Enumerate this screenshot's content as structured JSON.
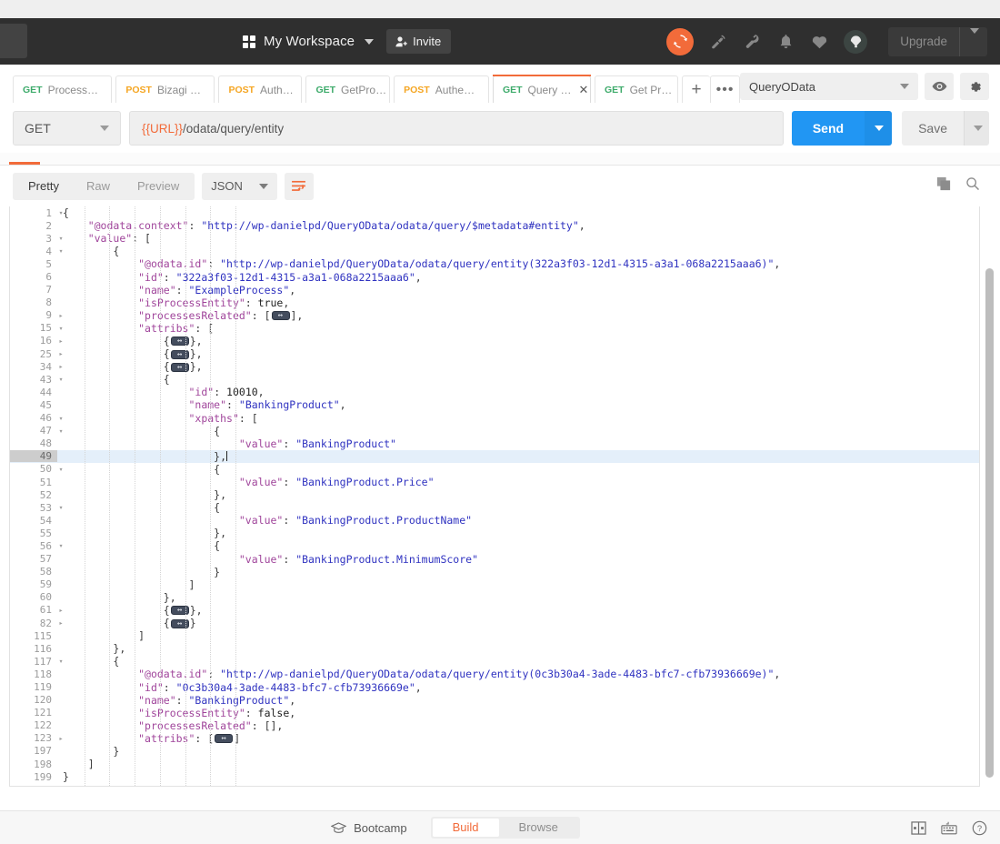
{
  "header": {
    "workspace_label": "My Workspace",
    "invite_label": "Invite",
    "upgrade_label": "Upgrade",
    "icons": [
      "grid-icon",
      "user-add-icon",
      "chevron-down-icon",
      "sync-icon",
      "satellite-icon",
      "wrench-icon",
      "bell-icon",
      "heart-icon",
      "parachute-icon"
    ],
    "accent_orange": "#f26b3a",
    "bg": "#2f2f2f"
  },
  "tabs": {
    "items": [
      {
        "method": "GET",
        "name": "Process…",
        "unsaved": true,
        "active": false,
        "closable": false
      },
      {
        "method": "POST",
        "name": "Bizagi …",
        "unsaved": true,
        "active": false,
        "closable": false
      },
      {
        "method": "POST",
        "name": "Auth…",
        "unsaved": false,
        "active": false,
        "closable": false
      },
      {
        "method": "GET",
        "name": "GetPro…",
        "unsaved": false,
        "active": false,
        "closable": false
      },
      {
        "method": "POST",
        "name": "Authe…",
        "unsaved": true,
        "active": false,
        "closable": false
      },
      {
        "method": "GET",
        "name": "Query …",
        "unsaved": false,
        "active": true,
        "closable": true
      },
      {
        "method": "GET",
        "name": "Get Pr…",
        "unsaved": false,
        "active": false,
        "closable": false
      }
    ],
    "new_tab_label": "+",
    "more_label": "•••",
    "environment": "QueryOData",
    "eye_icon": "eye-icon",
    "gear_icon": "gear-icon"
  },
  "request": {
    "method": "GET",
    "url_variable": "{{URL}}",
    "url_path": "/odata/query/entity",
    "send_label": "Send",
    "save_label": "Save"
  },
  "response": {
    "view_tabs": [
      {
        "label": "Pretty",
        "active": true
      },
      {
        "label": "Raw",
        "active": false
      },
      {
        "label": "Preview",
        "active": false
      }
    ],
    "format": "JSON",
    "wrap_icon": "word-wrap-icon",
    "copy_icon": "copy-icon",
    "search_icon": "search-icon",
    "highlighted_line": 49,
    "lines": [
      {
        "n": "1",
        "fold": "down",
        "indent": 0,
        "tokens": [
          {
            "t": "p",
            "v": "{"
          }
        ]
      },
      {
        "n": "2",
        "fold": "",
        "indent": 1,
        "tokens": [
          {
            "t": "k",
            "v": "\"@odata.context\""
          },
          {
            "t": "p",
            "v": ": "
          },
          {
            "t": "s",
            "v": "\"http://wp-danielpd/QueryOData/odata/query/$metadata#entity\""
          },
          {
            "t": "p",
            "v": ","
          }
        ]
      },
      {
        "n": "3",
        "fold": "down",
        "indent": 1,
        "tokens": [
          {
            "t": "k",
            "v": "\"value\""
          },
          {
            "t": "p",
            "v": ": ["
          }
        ]
      },
      {
        "n": "4",
        "fold": "down",
        "indent": 2,
        "tokens": [
          {
            "t": "p",
            "v": "{"
          }
        ]
      },
      {
        "n": "5",
        "fold": "",
        "indent": 3,
        "tokens": [
          {
            "t": "k",
            "v": "\"@odata.id\""
          },
          {
            "t": "p",
            "v": ": "
          },
          {
            "t": "s",
            "v": "\"http://wp-danielpd/QueryOData/odata/query/entity(322a3f03-12d1-4315-a3a1-068a2215aaa6)\""
          },
          {
            "t": "p",
            "v": ","
          }
        ]
      },
      {
        "n": "6",
        "fold": "",
        "indent": 3,
        "tokens": [
          {
            "t": "k",
            "v": "\"id\""
          },
          {
            "t": "p",
            "v": ": "
          },
          {
            "t": "s",
            "v": "\"322a3f03-12d1-4315-a3a1-068a2215aaa6\""
          },
          {
            "t": "p",
            "v": ","
          }
        ]
      },
      {
        "n": "7",
        "fold": "",
        "indent": 3,
        "tokens": [
          {
            "t": "k",
            "v": "\"name\""
          },
          {
            "t": "p",
            "v": ": "
          },
          {
            "t": "s",
            "v": "\"ExampleProcess\""
          },
          {
            "t": "p",
            "v": ","
          }
        ]
      },
      {
        "n": "8",
        "fold": "",
        "indent": 3,
        "tokens": [
          {
            "t": "k",
            "v": "\"isProcessEntity\""
          },
          {
            "t": "p",
            "v": ": "
          },
          {
            "t": "b",
            "v": "true"
          },
          {
            "t": "p",
            "v": ","
          }
        ]
      },
      {
        "n": "9",
        "fold": "right",
        "indent": 3,
        "tokens": [
          {
            "t": "k",
            "v": "\"processesRelated\""
          },
          {
            "t": "p",
            "v": ": ["
          },
          {
            "t": "badge",
            "v": ""
          },
          {
            "t": "p",
            "v": "],"
          }
        ]
      },
      {
        "n": "15",
        "fold": "down",
        "indent": 3,
        "tokens": [
          {
            "t": "k",
            "v": "\"attribs\""
          },
          {
            "t": "p",
            "v": ": ["
          }
        ]
      },
      {
        "n": "16",
        "fold": "right",
        "indent": 4,
        "tokens": [
          {
            "t": "p",
            "v": "{"
          },
          {
            "t": "badge",
            "v": ""
          },
          {
            "t": "p",
            "v": "},"
          }
        ]
      },
      {
        "n": "25",
        "fold": "right",
        "indent": 4,
        "tokens": [
          {
            "t": "p",
            "v": "{"
          },
          {
            "t": "badge",
            "v": ""
          },
          {
            "t": "p",
            "v": "},"
          }
        ]
      },
      {
        "n": "34",
        "fold": "right",
        "indent": 4,
        "tokens": [
          {
            "t": "p",
            "v": "{"
          },
          {
            "t": "badge",
            "v": ""
          },
          {
            "t": "p",
            "v": "},"
          }
        ]
      },
      {
        "n": "43",
        "fold": "down",
        "indent": 4,
        "tokens": [
          {
            "t": "p",
            "v": "{"
          }
        ]
      },
      {
        "n": "44",
        "fold": "",
        "indent": 5,
        "tokens": [
          {
            "t": "k",
            "v": "\"id\""
          },
          {
            "t": "p",
            "v": ": "
          },
          {
            "t": "n",
            "v": "10010"
          },
          {
            "t": "p",
            "v": ","
          }
        ]
      },
      {
        "n": "45",
        "fold": "",
        "indent": 5,
        "tokens": [
          {
            "t": "k",
            "v": "\"name\""
          },
          {
            "t": "p",
            "v": ": "
          },
          {
            "t": "s",
            "v": "\"BankingProduct\""
          },
          {
            "t": "p",
            "v": ","
          }
        ]
      },
      {
        "n": "46",
        "fold": "down",
        "indent": 5,
        "tokens": [
          {
            "t": "k",
            "v": "\"xpaths\""
          },
          {
            "t": "p",
            "v": ": ["
          }
        ]
      },
      {
        "n": "47",
        "fold": "down",
        "indent": 6,
        "tokens": [
          {
            "t": "p",
            "v": "{"
          }
        ]
      },
      {
        "n": "48",
        "fold": "",
        "indent": 7,
        "tokens": [
          {
            "t": "k",
            "v": "\"value\""
          },
          {
            "t": "p",
            "v": ": "
          },
          {
            "t": "s",
            "v": "\"BankingProduct\""
          }
        ]
      },
      {
        "n": "49",
        "fold": "",
        "indent": 6,
        "tokens": [
          {
            "t": "p",
            "v": "},"
          },
          {
            "t": "caret",
            "v": ""
          }
        ]
      },
      {
        "n": "50",
        "fold": "down",
        "indent": 6,
        "tokens": [
          {
            "t": "p",
            "v": "{"
          }
        ]
      },
      {
        "n": "51",
        "fold": "",
        "indent": 7,
        "tokens": [
          {
            "t": "k",
            "v": "\"value\""
          },
          {
            "t": "p",
            "v": ": "
          },
          {
            "t": "s",
            "v": "\"BankingProduct.Price\""
          }
        ]
      },
      {
        "n": "52",
        "fold": "",
        "indent": 6,
        "tokens": [
          {
            "t": "p",
            "v": "},"
          }
        ]
      },
      {
        "n": "53",
        "fold": "down",
        "indent": 6,
        "tokens": [
          {
            "t": "p",
            "v": "{"
          }
        ]
      },
      {
        "n": "54",
        "fold": "",
        "indent": 7,
        "tokens": [
          {
            "t": "k",
            "v": "\"value\""
          },
          {
            "t": "p",
            "v": ": "
          },
          {
            "t": "s",
            "v": "\"BankingProduct.ProductName\""
          }
        ]
      },
      {
        "n": "55",
        "fold": "",
        "indent": 6,
        "tokens": [
          {
            "t": "p",
            "v": "},"
          }
        ]
      },
      {
        "n": "56",
        "fold": "down",
        "indent": 6,
        "tokens": [
          {
            "t": "p",
            "v": "{"
          }
        ]
      },
      {
        "n": "57",
        "fold": "",
        "indent": 7,
        "tokens": [
          {
            "t": "k",
            "v": "\"value\""
          },
          {
            "t": "p",
            "v": ": "
          },
          {
            "t": "s",
            "v": "\"BankingProduct.MinimumScore\""
          }
        ]
      },
      {
        "n": "58",
        "fold": "",
        "indent": 6,
        "tokens": [
          {
            "t": "p",
            "v": "}"
          }
        ]
      },
      {
        "n": "59",
        "fold": "",
        "indent": 5,
        "tokens": [
          {
            "t": "p",
            "v": "]"
          }
        ]
      },
      {
        "n": "60",
        "fold": "",
        "indent": 4,
        "tokens": [
          {
            "t": "p",
            "v": "},"
          }
        ]
      },
      {
        "n": "61",
        "fold": "right",
        "indent": 4,
        "tokens": [
          {
            "t": "p",
            "v": "{"
          },
          {
            "t": "badge",
            "v": ""
          },
          {
            "t": "p",
            "v": "},"
          }
        ]
      },
      {
        "n": "82",
        "fold": "right",
        "indent": 4,
        "tokens": [
          {
            "t": "p",
            "v": "{"
          },
          {
            "t": "badge",
            "v": ""
          },
          {
            "t": "p",
            "v": "}"
          }
        ]
      },
      {
        "n": "115",
        "fold": "",
        "indent": 3,
        "tokens": [
          {
            "t": "p",
            "v": "]"
          }
        ]
      },
      {
        "n": "116",
        "fold": "",
        "indent": 2,
        "tokens": [
          {
            "t": "p",
            "v": "},"
          }
        ]
      },
      {
        "n": "117",
        "fold": "down",
        "indent": 2,
        "tokens": [
          {
            "t": "p",
            "v": "{"
          }
        ]
      },
      {
        "n": "118",
        "fold": "",
        "indent": 3,
        "tokens": [
          {
            "t": "k",
            "v": "\"@odata.id\""
          },
          {
            "t": "p",
            "v": ": "
          },
          {
            "t": "s",
            "v": "\"http://wp-danielpd/QueryOData/odata/query/entity(0c3b30a4-3ade-4483-bfc7-cfb73936669e)\""
          },
          {
            "t": "p",
            "v": ","
          }
        ]
      },
      {
        "n": "119",
        "fold": "",
        "indent": 3,
        "tokens": [
          {
            "t": "k",
            "v": "\"id\""
          },
          {
            "t": "p",
            "v": ": "
          },
          {
            "t": "s",
            "v": "\"0c3b30a4-3ade-4483-bfc7-cfb73936669e\""
          },
          {
            "t": "p",
            "v": ","
          }
        ]
      },
      {
        "n": "120",
        "fold": "",
        "indent": 3,
        "tokens": [
          {
            "t": "k",
            "v": "\"name\""
          },
          {
            "t": "p",
            "v": ": "
          },
          {
            "t": "s",
            "v": "\"BankingProduct\""
          },
          {
            "t": "p",
            "v": ","
          }
        ]
      },
      {
        "n": "121",
        "fold": "",
        "indent": 3,
        "tokens": [
          {
            "t": "k",
            "v": "\"isProcessEntity\""
          },
          {
            "t": "p",
            "v": ": "
          },
          {
            "t": "b",
            "v": "false"
          },
          {
            "t": "p",
            "v": ","
          }
        ]
      },
      {
        "n": "122",
        "fold": "",
        "indent": 3,
        "tokens": [
          {
            "t": "k",
            "v": "\"processesRelated\""
          },
          {
            "t": "p",
            "v": ": [],"
          }
        ]
      },
      {
        "n": "123",
        "fold": "right",
        "indent": 3,
        "tokens": [
          {
            "t": "k",
            "v": "\"attribs\""
          },
          {
            "t": "p",
            "v": ": ["
          },
          {
            "t": "badge",
            "v": ""
          },
          {
            "t": "p",
            "v": "]"
          }
        ]
      },
      {
        "n": "197",
        "fold": "",
        "indent": 2,
        "tokens": [
          {
            "t": "p",
            "v": "}"
          }
        ]
      },
      {
        "n": "198",
        "fold": "",
        "indent": 1,
        "tokens": [
          {
            "t": "p",
            "v": "]"
          }
        ]
      },
      {
        "n": "199",
        "fold": "",
        "indent": 0,
        "tokens": [
          {
            "t": "p",
            "v": "}"
          }
        ]
      }
    ]
  },
  "bottom_bar": {
    "bootcamp_label": "Bootcamp",
    "bootcamp_icon": "graduation-cap-icon",
    "modes": [
      {
        "label": "Build",
        "active": true
      },
      {
        "label": "Browse",
        "active": false
      }
    ],
    "icons": [
      "two-pane-layout-icon",
      "keyboard-icon",
      "help-icon"
    ]
  }
}
